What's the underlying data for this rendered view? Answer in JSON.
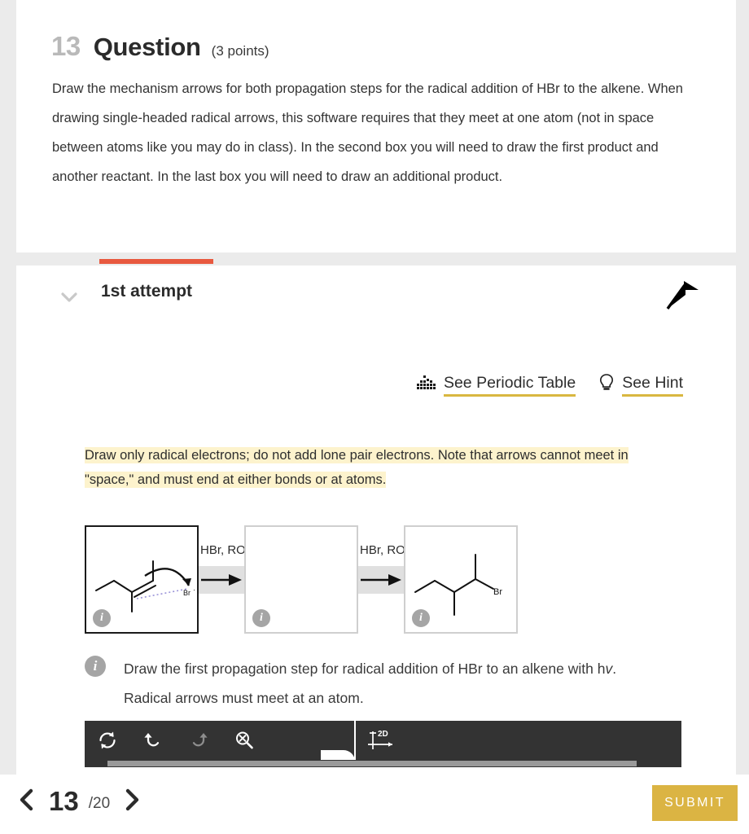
{
  "question": {
    "number": "13",
    "title": "Question",
    "points": "(3 points)",
    "body": "Draw the mechanism arrows for both propagation steps for the radical addition of HBr to the alkene. When drawing single-headed radical arrows, this software requires that they meet at one atom (not in space between atoms like you may do in class). In the second box you will need to draw the first product and another reactant. In the last box you will need to draw an additional product."
  },
  "attempt": {
    "label": "1st attempt",
    "accent_color": "#e8593f"
  },
  "help": {
    "periodic_table": "See Periodic Table",
    "hint": "See Hint",
    "underline_color": "#d9b740"
  },
  "note": {
    "text": "Draw only radical electrons; do not add lone pair electrons. Note that arrows cannot meet in \"space,\" and must end at either bonds or at atoms.",
    "highlight_color": "#fdf3cd"
  },
  "scheme": {
    "boxes": [
      {
        "name": "reactant-box",
        "state": "active",
        "info": "i",
        "content": "alkene-with-radical-arrow",
        "atom_label": "Br"
      },
      {
        "name": "intermediate-box",
        "state": "empty",
        "info": "i",
        "content": "empty",
        "atom_label": ""
      },
      {
        "name": "product-box",
        "state": "filled",
        "info": "i",
        "content": "bromoalkane-product",
        "atom_label": "Br"
      }
    ],
    "reagents": [
      {
        "label": "HBr, RO"
      },
      {
        "label": "HBr, RO"
      }
    ]
  },
  "instruction": {
    "info": "i",
    "text_before": "Draw the first propagation step for radical addition of HBr to an alkene with h",
    "text_italic": "v",
    "text_after": ". Radical arrows must meet at an atom."
  },
  "toolbar": {
    "tools": [
      {
        "name": "reset-icon",
        "label": "Reset"
      },
      {
        "name": "undo-icon",
        "label": "Undo"
      },
      {
        "name": "redo-icon",
        "label": "Redo"
      },
      {
        "name": "erase-zoom-icon",
        "label": "Clear"
      }
    ],
    "mode_label": "2D",
    "background": "#333333"
  },
  "nav": {
    "prev": "‹",
    "next": "›",
    "current_page": "13",
    "total_pages": "/20",
    "submit_label": "SUBMIT",
    "submit_color": "#dbb443"
  }
}
